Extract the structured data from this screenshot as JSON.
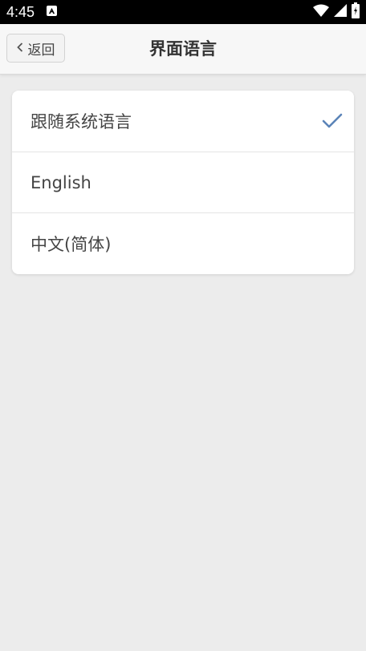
{
  "status_bar": {
    "time": "4:45",
    "icons": [
      "notification-a-icon",
      "wifi-icon",
      "signal-icon",
      "battery-icon"
    ]
  },
  "nav": {
    "back_label": "返回",
    "title": "界面语言"
  },
  "language_options": [
    {
      "label": "跟随系统语言",
      "selected": true
    },
    {
      "label": "English",
      "selected": false
    },
    {
      "label": "中文(简体)",
      "selected": false
    }
  ],
  "colors": {
    "accent": "#5b84b8",
    "background": "#ececec",
    "status_bar": "#000000"
  }
}
